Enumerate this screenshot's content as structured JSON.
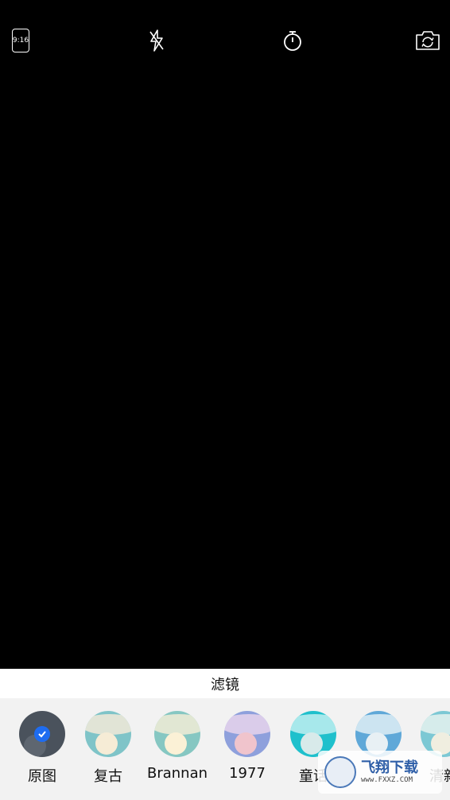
{
  "topbar": {
    "ratio_label": "9:16",
    "icons": [
      "aspect-ratio-icon",
      "flash-off-icon",
      "timer-icon",
      "switch-camera-icon"
    ]
  },
  "filter_panel": {
    "title": "滤镜",
    "items": [
      {
        "label": "原图",
        "selected": true
      },
      {
        "label": "复古",
        "selected": false
      },
      {
        "label": "Brannan",
        "selected": false
      },
      {
        "label": "1977",
        "selected": false
      },
      {
        "label": "童话",
        "selected": false
      },
      {
        "label": "",
        "selected": false
      },
      {
        "label": "清新",
        "selected": false
      }
    ]
  },
  "watermark": {
    "brand": "飞翔下载",
    "url": "www.FXXZ.COM"
  },
  "colors": {
    "selected_check": "#1e6cf0",
    "panel_bg": "#f2f2f2",
    "viewfinder_bg": "#000000"
  }
}
